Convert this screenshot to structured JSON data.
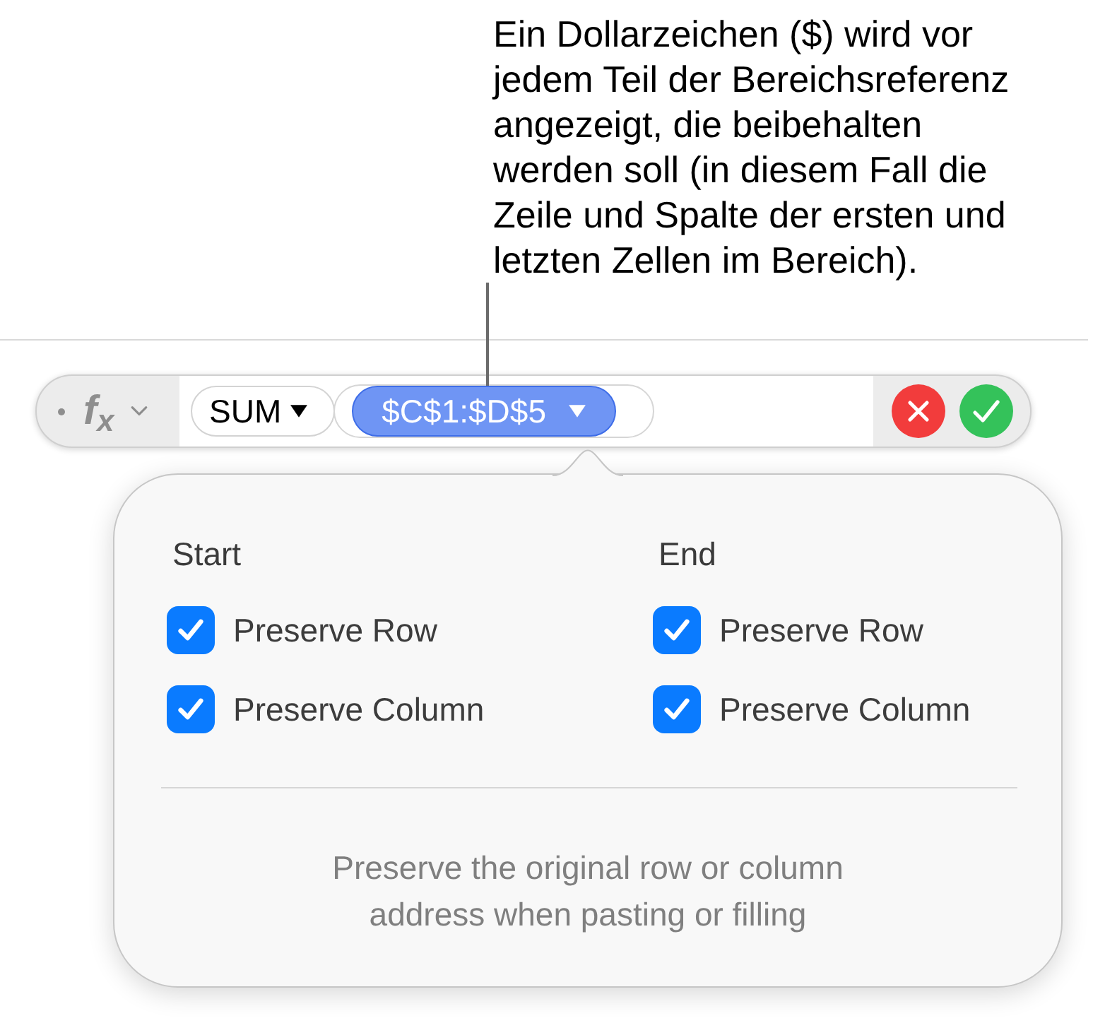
{
  "callout": {
    "text": "Ein Dollarzeichen ($) wird vor jedem Teil der Bereichsreferenz angezeigt, die beibehalten werden soll (in diesem Fall die Zeile und Spalte der ersten und letzten Zellen im Bereich)."
  },
  "formula_bar": {
    "symbol": "f$_{x}$",
    "function": {
      "name": "SUM",
      "selected": false
    },
    "arguments": [
      {
        "reference": "$C$1:$D$5",
        "selected": true
      }
    ]
  },
  "popover": {
    "columns": [
      {
        "heading": "Start",
        "options": [
          {
            "label": "Preserve Row",
            "checked": true
          },
          {
            "label": "Preserve Column",
            "checked": true
          }
        ]
      },
      {
        "heading": "End",
        "options": [
          {
            "label": "Preserve Row",
            "checked": true
          },
          {
            "label": "Preserve Column",
            "checked": true
          }
        ]
      }
    ],
    "description": "Preserve the original row or column address when pasting or filling"
  }
}
